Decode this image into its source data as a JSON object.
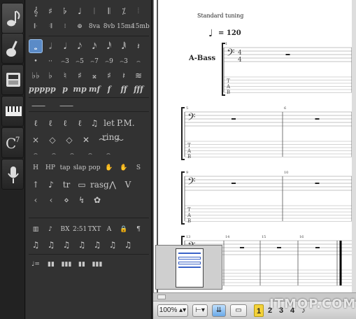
{
  "tabs": [
    {
      "id": "notation",
      "icon": "eighth-note-icon"
    },
    {
      "id": "guitar",
      "icon": "guitar-icon"
    },
    {
      "id": "effects",
      "icon": "amplifier-icon"
    },
    {
      "id": "keyboard",
      "icon": "keyboard-icon"
    },
    {
      "id": "chord",
      "icon": "chord-c7-icon",
      "label": "C7"
    },
    {
      "id": "lyrics",
      "icon": "microphone-icon"
    }
  ],
  "palette": {
    "row_top": [
      "𝄞",
      "♯",
      "𝄬",
      "♩",
      "𝄀",
      "𝄃",
      "⁒",
      "𝄄"
    ],
    "row2": [
      "𝄆",
      "𝄇",
      "⁝",
      "⊕",
      "8va",
      "8vb",
      "15ma",
      "15mb"
    ],
    "durations": [
      "𝅝",
      "𝅗𝅥",
      "𝅘𝅥",
      "𝅘𝅥𝅮",
      "𝅘𝅥𝅯",
      "𝅘𝅥𝅰",
      "𝅘𝅥𝅱",
      "𝄽"
    ],
    "tuplets": [
      "•",
      "··",
      "⌢3",
      "⌢5",
      "⌢7",
      "⌢9",
      "⌢3",
      "⌢"
    ],
    "accidentals": [
      "♭♭",
      "♭",
      "♮",
      "♯",
      "𝄪",
      "♯",
      "𝄽",
      "≋"
    ],
    "dynamics": [
      "ppp",
      "pp",
      "p",
      "mp",
      "mf",
      "f",
      "ff",
      "fff"
    ],
    "hairpins": [
      "⸺",
      "⸺"
    ],
    "articulations": [
      "ℓ",
      "ℓ",
      "ℓ",
      "ℓ",
      "♫",
      "let ring",
      "P.M."
    ],
    "ornaments": [
      "×",
      "◇",
      "◇",
      "✕",
      "〜",
      "〜"
    ],
    "slides": [
      "⌢",
      "⌢",
      "⌢",
      "⌢",
      "⌢"
    ],
    "techniques": [
      "H",
      "HP",
      "tap",
      "slap",
      "pop",
      "✋",
      "✋",
      "S"
    ],
    "bends": [
      "↑",
      "♪",
      "tr",
      "▭",
      "rasg.",
      "⋀",
      "V"
    ],
    "misc": [
      "‹",
      "‹",
      "⋄",
      "↯",
      "✿"
    ],
    "text_tools": [
      "▥",
      "♪",
      "BX",
      "2:51",
      "TXT",
      "A",
      "🔒",
      "¶"
    ],
    "chords": [
      "♫",
      "♫",
      "♫",
      "♫",
      "♫",
      "♫",
      "♫"
    ],
    "volume": [
      "♩=",
      "▮▮",
      "▮▮▮",
      "▮▮",
      "▮▮▮"
    ]
  },
  "score": {
    "tuning": "Standard tuning",
    "tempo_symbol": "♩",
    "tempo_value": "= 120",
    "track_name": "A-Bass",
    "time_sig_top": "4",
    "time_sig_bottom": "4",
    "tab_label": [
      "T",
      "A",
      "B"
    ],
    "measure_numbers": [
      "1",
      "5",
      "6",
      "9",
      "10",
      "13",
      "14",
      "15",
      "16"
    ]
  },
  "bottom": {
    "zoom": "100%",
    "pages": [
      "1",
      "2",
      "3",
      "4"
    ],
    "active_page": "1",
    "watermark": "ITMOP.COM"
  }
}
